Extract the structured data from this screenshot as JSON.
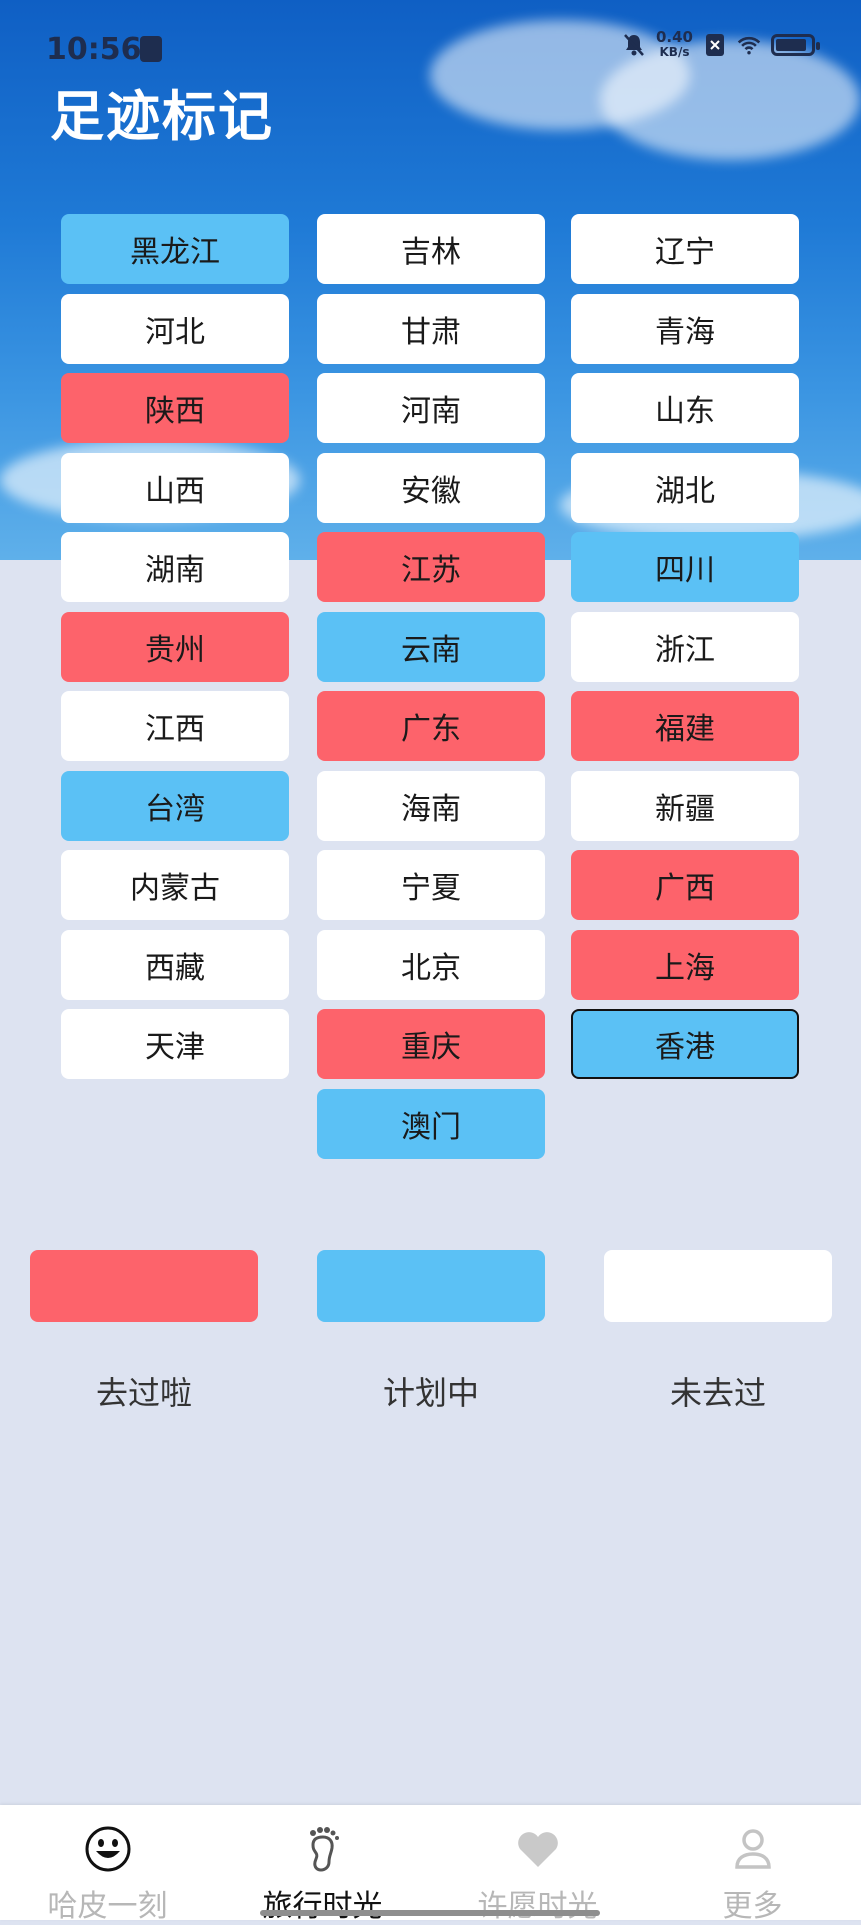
{
  "status_bar": {
    "time": "10:56",
    "net_speed_value": "0.40",
    "net_speed_unit": "KB/s"
  },
  "header": {
    "title": "足迹标记"
  },
  "colors": {
    "visited": "#fd636b",
    "planned": "#5bc1f5",
    "not_visited": "#ffffff"
  },
  "provinces": [
    {
      "name": "黑龙江",
      "status": "planned"
    },
    {
      "name": "吉林",
      "status": "not_visited"
    },
    {
      "name": "辽宁",
      "status": "not_visited"
    },
    {
      "name": "河北",
      "status": "not_visited"
    },
    {
      "name": "甘肃",
      "status": "not_visited"
    },
    {
      "name": "青海",
      "status": "not_visited"
    },
    {
      "name": "陕西",
      "status": "visited"
    },
    {
      "name": "河南",
      "status": "not_visited"
    },
    {
      "name": "山东",
      "status": "not_visited"
    },
    {
      "name": "山西",
      "status": "not_visited"
    },
    {
      "name": "安徽",
      "status": "not_visited"
    },
    {
      "name": "湖北",
      "status": "not_visited"
    },
    {
      "name": "湖南",
      "status": "not_visited"
    },
    {
      "name": "江苏",
      "status": "visited"
    },
    {
      "name": "四川",
      "status": "planned"
    },
    {
      "name": "贵州",
      "status": "visited"
    },
    {
      "name": "云南",
      "status": "planned"
    },
    {
      "name": "浙江",
      "status": "not_visited"
    },
    {
      "name": "江西",
      "status": "not_visited"
    },
    {
      "name": "广东",
      "status": "visited"
    },
    {
      "name": "福建",
      "status": "visited"
    },
    {
      "name": "台湾",
      "status": "planned"
    },
    {
      "name": "海南",
      "status": "not_visited"
    },
    {
      "name": "新疆",
      "status": "not_visited"
    },
    {
      "name": "内蒙古",
      "status": "not_visited"
    },
    {
      "name": "宁夏",
      "status": "not_visited"
    },
    {
      "name": "广西",
      "status": "visited"
    },
    {
      "name": "西藏",
      "status": "not_visited"
    },
    {
      "name": "北京",
      "status": "not_visited"
    },
    {
      "name": "上海",
      "status": "visited"
    },
    {
      "name": "天津",
      "status": "not_visited"
    },
    {
      "name": "重庆",
      "status": "visited"
    },
    {
      "name": "香港",
      "status": "planned",
      "selected": true
    },
    {
      "name": "澳门",
      "status": "planned"
    }
  ],
  "legend": [
    {
      "label": "去过啦",
      "status": "visited"
    },
    {
      "label": "计划中",
      "status": "planned"
    },
    {
      "label": "未去过",
      "status": "not_visited"
    }
  ],
  "bottom_nav": [
    {
      "label": "哈皮一刻",
      "icon": "smiley-face-icon",
      "active": false
    },
    {
      "label": "旅行时光",
      "icon": "footprint-icon",
      "active": true
    },
    {
      "label": "许愿时光",
      "icon": "heart-icon",
      "active": false
    },
    {
      "label": "更多",
      "icon": "person-icon",
      "active": false
    }
  ]
}
